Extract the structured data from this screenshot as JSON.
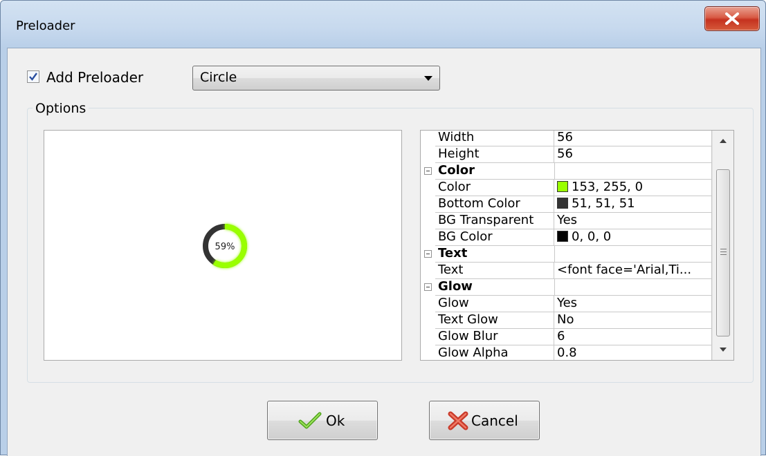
{
  "window": {
    "title": "Preloader"
  },
  "controls": {
    "add_preloader_label": "Add Preloader",
    "add_preloader_checked": true,
    "preloader_type": "Circle"
  },
  "options": {
    "group_label": "Options",
    "preview": {
      "percent_text": "59%",
      "progress": 0.59,
      "ring_color": "#99ff00",
      "track_color": "#333333"
    }
  },
  "properties": {
    "rows": [
      {
        "name": "Width",
        "value": "56"
      },
      {
        "name": "Height",
        "value": "56"
      },
      {
        "category": "Color"
      },
      {
        "name": "Color",
        "value": "153, 255, 0",
        "swatch": "#99ff00"
      },
      {
        "name": "Bottom Color",
        "value": "51, 51, 51",
        "swatch": "#333333"
      },
      {
        "name": "BG Transparent",
        "value": "Yes"
      },
      {
        "name": "BG Color",
        "value": "0, 0, 0",
        "swatch": "#000000"
      },
      {
        "category": "Text"
      },
      {
        "name": "Text",
        "value": "<font face='Arial,Ti..."
      },
      {
        "category": "Glow"
      },
      {
        "name": "Glow",
        "value": "Yes"
      },
      {
        "name": "Text Glow",
        "value": "No"
      },
      {
        "name": "Glow Blur",
        "value": "6"
      },
      {
        "name": "Glow Alpha",
        "value": "0.8"
      }
    ]
  },
  "buttons": {
    "ok_label": "Ok",
    "cancel_label": "Cancel"
  }
}
